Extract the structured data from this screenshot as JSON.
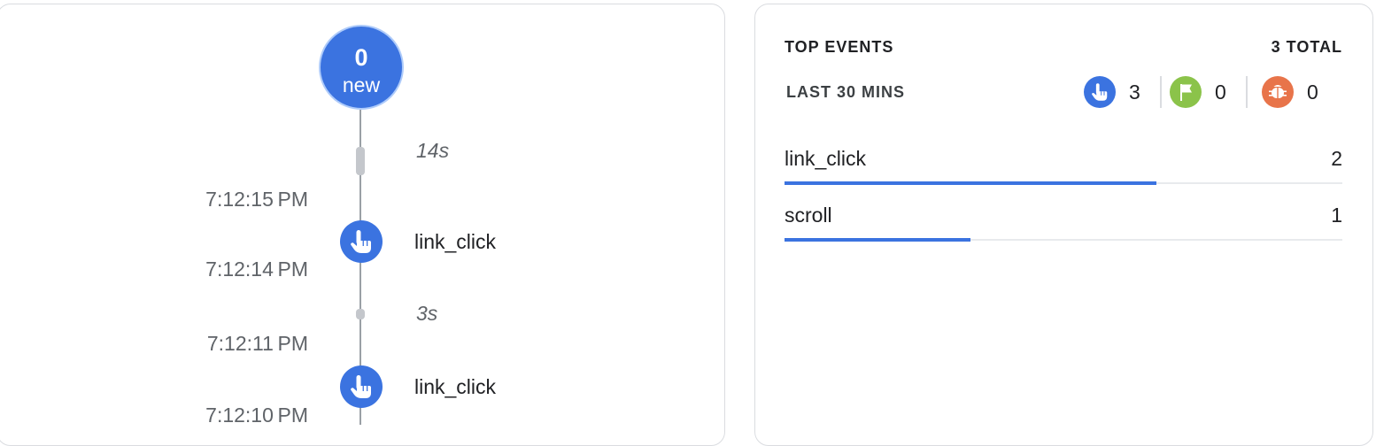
{
  "stream": {
    "new_count": "0",
    "new_label": "new",
    "gap_1": "14s",
    "time_1": "7:12:15 PM",
    "event_1": "link_click",
    "time_2": "7:12:14 PM",
    "gap_2": "3s",
    "time_3": "7:12:11 PM",
    "event_2": "link_click",
    "time_4": "7:12:10 PM",
    "event_icon": "touch-icon"
  },
  "top_events": {
    "title": "TOP EVENTS",
    "total": "3 TOTAL",
    "range": "LAST 30 MINS",
    "stats": [
      {
        "icon": "touch-icon",
        "count": "3",
        "color": "#3b73e0"
      },
      {
        "icon": "flag-icon",
        "count": "0",
        "color": "#8bc34a"
      },
      {
        "icon": "bug-icon",
        "count": "0",
        "color": "#e8744a"
      }
    ],
    "rows": [
      {
        "name": "link_click",
        "value": "2",
        "fraction": 0.6667
      },
      {
        "name": "scroll",
        "value": "1",
        "fraction": 0.3333
      }
    ]
  }
}
